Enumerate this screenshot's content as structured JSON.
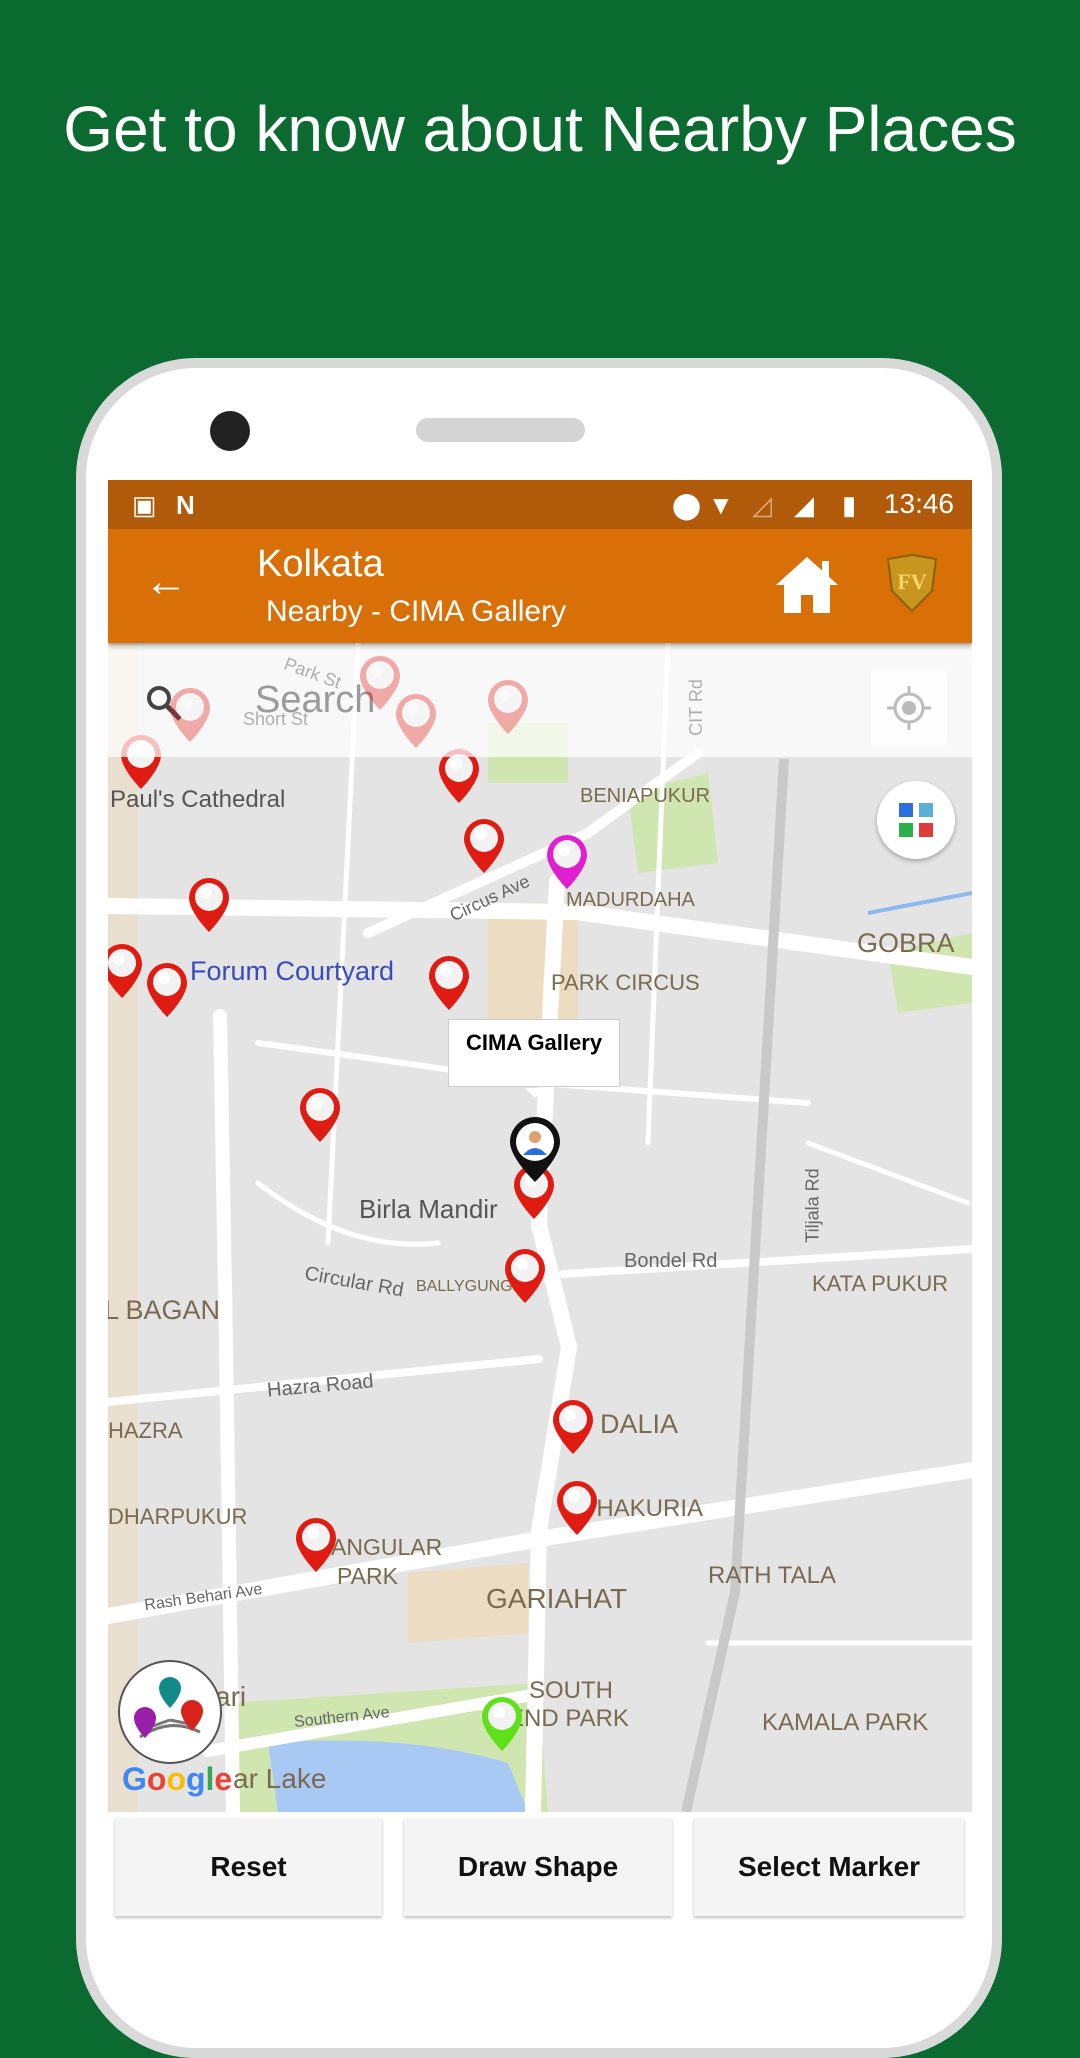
{
  "promo": {
    "headline": "Get to know about Nearby Places"
  },
  "status_bar": {
    "time": "13:46",
    "icons": [
      "image-icon",
      "n-icon",
      "location-icon",
      "wifi-icon",
      "signal-empty-icon",
      "signal-icon",
      "battery-charging-icon"
    ]
  },
  "app_bar": {
    "title": "Kolkata",
    "subtitle": "Nearby - CIMA Gallery",
    "icons": [
      "back-arrow-icon",
      "home-icon",
      "fv-logo-icon"
    ]
  },
  "search": {
    "placeholder": "Search"
  },
  "map": {
    "info_window": "CIMA Gallery",
    "labels": {
      "pauls_cathedral": "Paul's Cathedral",
      "beniapukur": "BENIAPUKUR",
      "circus_ave": "Circus Ave",
      "madurdaha": "MADURDAHA",
      "gobra": "GOBRA",
      "forum_courtyard": "Forum Courtyard",
      "park_circus": "PARK CIRCUS",
      "tiljala_rd": "Tiljala Rd",
      "birla_mandir": "Birla Mandir",
      "bondel_rd": "Bondel Rd",
      "circular_rd": "Circular Rd",
      "ballygunge": "BALLYGUNGE",
      "kata_pukur": "KATA PUKUR",
      "l_bagan": "L BAGAN",
      "hazra_road": "Hazra Road",
      "hazra": "HAZRA",
      "dalia": "DALIA",
      "dharpukur": "DHARPUKUR",
      "dhakuria": "DHAKURIA",
      "angular": "ANGULAR",
      "park": "PARK",
      "rath_tala": "RATH TALA",
      "rash_behari_ave": "Rash Behari Ave",
      "gariahat": "GARIAHAT",
      "south": "SOUTH",
      "end_park": "END PARK",
      "kamala_park": "KAMALA PARK",
      "southern_ave": "Southern Ave",
      "ari": "ari",
      "ar_lake": "ar Lake",
      "park_st": "Park St",
      "short_st": "Short St",
      "cit_rd": "CIT Rd"
    },
    "google_logo": "Google",
    "colors": {
      "marker_default": "#e01b12",
      "marker_selected": "#e020d0",
      "marker_current": "#5ee01a",
      "poi_label": "#7a6a50",
      "link_label": "#3a4bbf"
    }
  },
  "buttons": {
    "reset": "Reset",
    "draw_shape": "Draw Shape",
    "select_marker": "Select Marker"
  }
}
